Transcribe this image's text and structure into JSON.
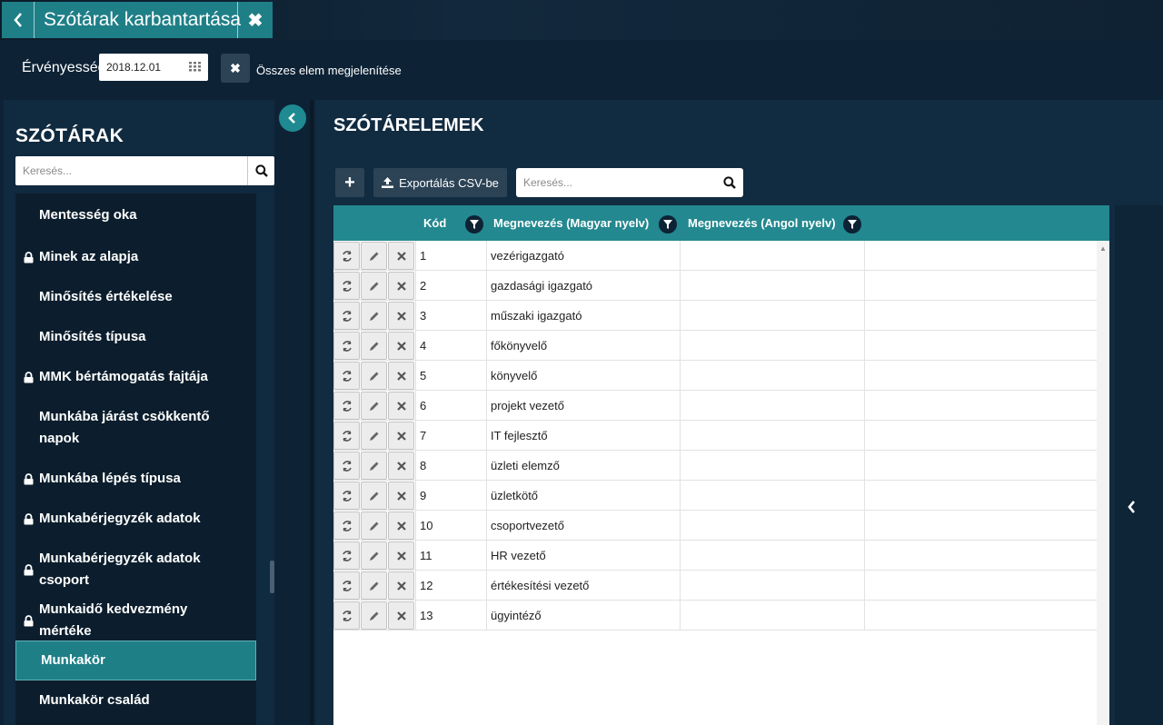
{
  "window": {
    "title": "Szótárak karbantartása"
  },
  "filter": {
    "validity_label": "Érvényesség",
    "date_value": "2018.12.01",
    "show_all_label": "Összes elem megjelenítése"
  },
  "dictionaries": {
    "title": "SZÓTÁRAK",
    "search_placeholder": "Keresés...",
    "items": [
      {
        "label": "Mentesség oka",
        "locked": false
      },
      {
        "label": "Minek az alapja",
        "locked": true
      },
      {
        "label": "Minősítés értékelése",
        "locked": false
      },
      {
        "label": "Minősítés típusa",
        "locked": false
      },
      {
        "label": "MMK bértámogatás fajtája",
        "locked": true
      },
      {
        "label": "Munkába járást csökkentő napok",
        "locked": false
      },
      {
        "label": "Munkába lépés típusa",
        "locked": true
      },
      {
        "label": "Munkabérjegyzék adatok",
        "locked": true
      },
      {
        "label": "Munkabérjegyzék adatok csoport",
        "locked": true
      },
      {
        "label": "Munkaidő kedvezmény mértéke",
        "locked": true
      },
      {
        "label": "Munkakör",
        "locked": false,
        "active": true
      },
      {
        "label": "Munkakör család",
        "locked": false
      }
    ]
  },
  "elements": {
    "title": "SZÓTÁRELEMEK",
    "add_label": "+",
    "export_label": "Exportálás CSV-be",
    "search_placeholder": "Keresés...",
    "columns": {
      "code": "Kód",
      "name_hu": "Megnevezés (Magyar nyelv)",
      "name_en": "Megnevezés (Angol nyelv)"
    },
    "rows": [
      {
        "code": "1",
        "name_hu": "vezérigazgató",
        "name_en": ""
      },
      {
        "code": "2",
        "name_hu": "gazdasági igazgató",
        "name_en": ""
      },
      {
        "code": "3",
        "name_hu": "műszaki igazgató",
        "name_en": ""
      },
      {
        "code": "4",
        "name_hu": "főkönyvelő",
        "name_en": ""
      },
      {
        "code": "5",
        "name_hu": "könyvelő",
        "name_en": ""
      },
      {
        "code": "6",
        "name_hu": "projekt vezető",
        "name_en": ""
      },
      {
        "code": "7",
        "name_hu": "IT fejlesztő",
        "name_en": ""
      },
      {
        "code": "8",
        "name_hu": "üzleti elemző",
        "name_en": ""
      },
      {
        "code": "9",
        "name_hu": "üzletkötő",
        "name_en": ""
      },
      {
        "code": "10",
        "name_hu": "csoportvezető",
        "name_en": ""
      },
      {
        "code": "11",
        "name_hu": "HR vezető",
        "name_en": ""
      },
      {
        "code": "12",
        "name_hu": "értékesítési vezető",
        "name_en": ""
      },
      {
        "code": "13",
        "name_hu": "ügyintéző",
        "name_en": ""
      }
    ]
  },
  "colors": {
    "accent": "#1f7f87",
    "header_teal": "#23888f",
    "panel_bg": "#102a3f"
  }
}
